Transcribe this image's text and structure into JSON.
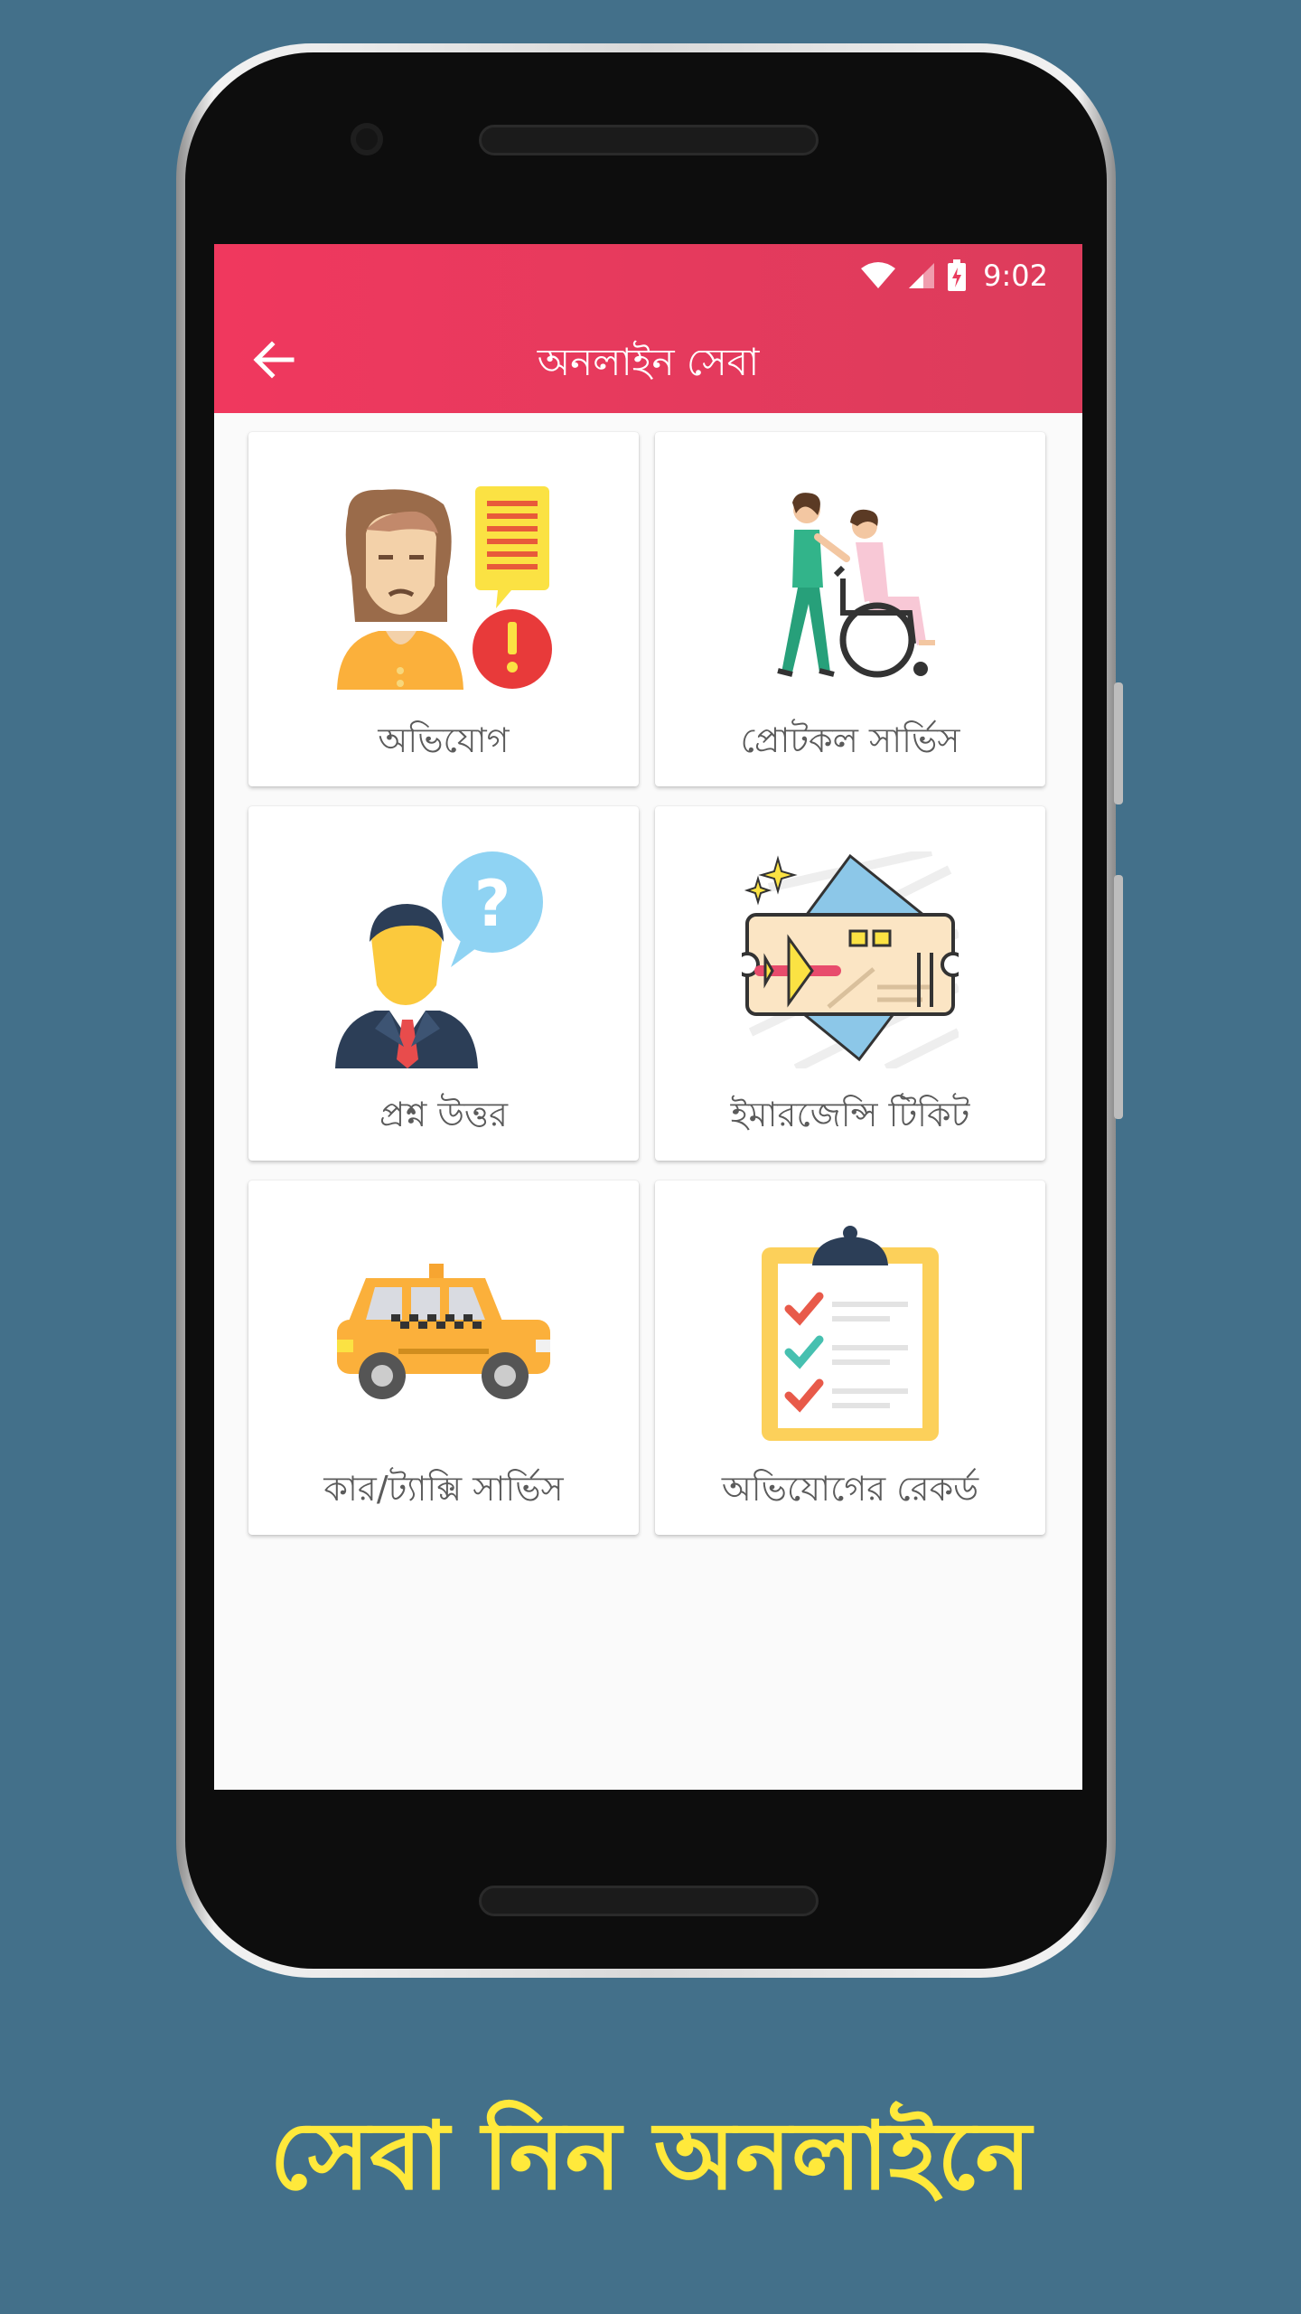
{
  "status_bar": {
    "time": "9:02",
    "icons": [
      "wifi-icon",
      "cell-signal-icon",
      "battery-charging-icon"
    ]
  },
  "app_bar": {
    "title": "অনলাইন সেবা",
    "back_icon": "arrow-left-icon"
  },
  "colors": {
    "app_bar": "#e93b5e",
    "background": "#43708a",
    "tagline": "#ffe93b",
    "card_label": "#5b5b5b"
  },
  "services": [
    {
      "label": "অভিযোগ",
      "icon": "complaint-woman-icon"
    },
    {
      "label": "প্রোটকল সার্ভিস",
      "icon": "wheelchair-assist-icon"
    },
    {
      "label": "প্রশ্ন উত্তর",
      "icon": "question-answer-icon"
    },
    {
      "label": "ইমারজেন্সি টিকিট",
      "icon": "plane-ticket-icon"
    },
    {
      "label": "কার/ট্যাক্সি সার্ভিস",
      "icon": "taxi-icon"
    },
    {
      "label": "অভিযোগের রেকর্ড",
      "icon": "clipboard-checklist-icon"
    }
  ],
  "tagline": "সেবা নিন অনলাইনে"
}
